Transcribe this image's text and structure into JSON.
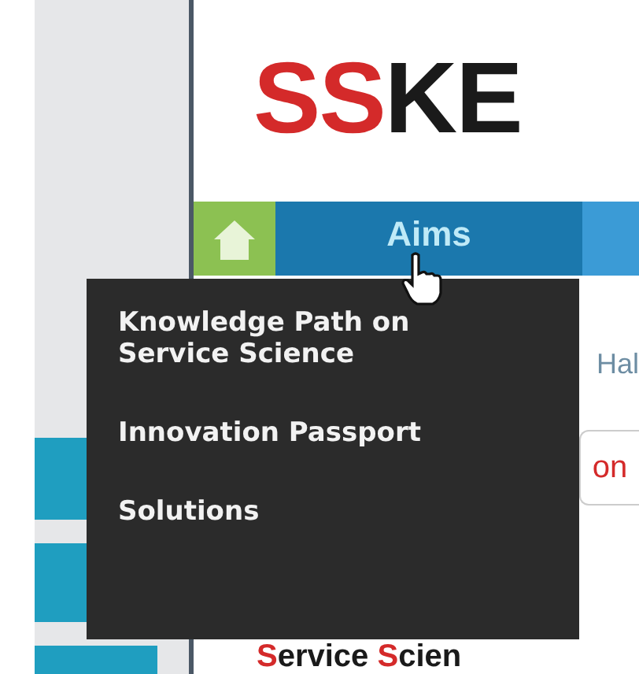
{
  "logo": {
    "parts": [
      {
        "text": "SS",
        "accent": true
      },
      {
        "text": "KE",
        "accent": false
      }
    ]
  },
  "nav": {
    "items": [
      {
        "kind": "home",
        "selected": false
      },
      {
        "kind": "label",
        "label": "Aims",
        "selected": true
      }
    ]
  },
  "dropdown": {
    "items": [
      "Knowledge Path on Service Science",
      "Innovation Passport",
      "Solutions"
    ]
  },
  "content": {
    "greeting": "Hal",
    "button": "on",
    "heading": [
      {
        "text": "S",
        "accent": true
      },
      {
        "text": "ervice ",
        "accent": false
      },
      {
        "text": "S",
        "accent": true
      },
      {
        "text": "cien",
        "accent": false
      }
    ]
  }
}
